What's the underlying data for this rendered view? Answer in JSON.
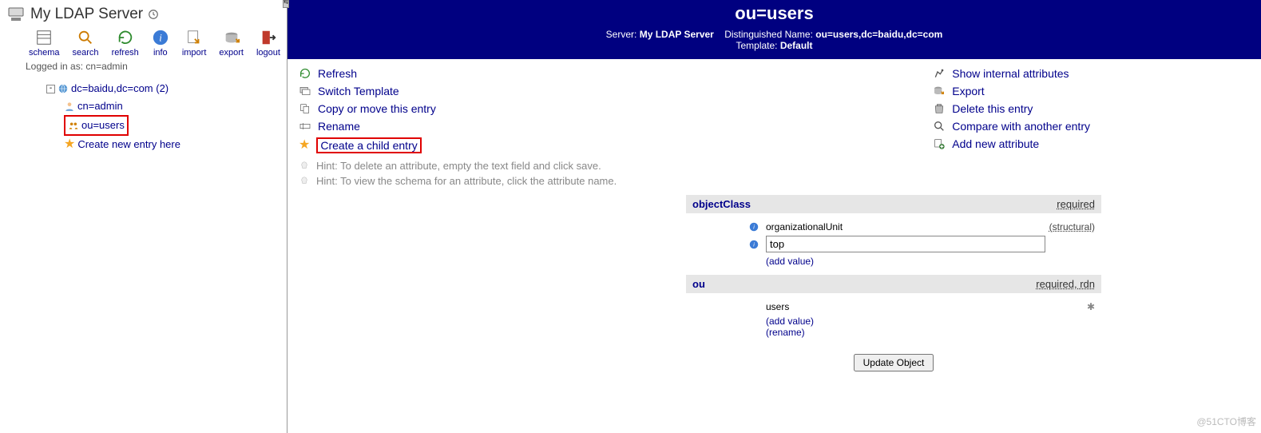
{
  "server": {
    "title": "My LDAP Server",
    "logged_in": "Logged in as: cn=admin"
  },
  "toolbar": [
    {
      "id": "schema",
      "label": "schema"
    },
    {
      "id": "search",
      "label": "search"
    },
    {
      "id": "refresh",
      "label": "refresh"
    },
    {
      "id": "info",
      "label": "info"
    },
    {
      "id": "import",
      "label": "import"
    },
    {
      "id": "export",
      "label": "export"
    },
    {
      "id": "logout",
      "label": "logout"
    }
  ],
  "tree": {
    "root": "dc=baidu,dc=com (2)",
    "children": [
      {
        "label": "cn=admin",
        "icon": "person"
      },
      {
        "label": "ou=users",
        "icon": "ou",
        "highlight": true
      },
      {
        "label": "Create new entry here",
        "icon": "star"
      }
    ]
  },
  "entry": {
    "title": "ou=users",
    "meta": {
      "server_label": "Server:",
      "server_value": "My LDAP Server",
      "dn_label": "Distinguished Name:",
      "dn_value": "ou=users,dc=baidu,dc=com",
      "tmpl_label": "Template:",
      "tmpl_value": "Default"
    }
  },
  "actions_left": [
    {
      "id": "refresh",
      "label": "Refresh"
    },
    {
      "id": "switch-template",
      "label": "Switch Template"
    },
    {
      "id": "copy-move",
      "label": "Copy or move this entry"
    },
    {
      "id": "rename",
      "label": "Rename"
    },
    {
      "id": "create-child",
      "label": "Create a child entry",
      "highlight": true
    }
  ],
  "actions_right": [
    {
      "id": "show-internal",
      "label": "Show internal attributes"
    },
    {
      "id": "export",
      "label": "Export"
    },
    {
      "id": "delete",
      "label": "Delete this entry"
    },
    {
      "id": "compare",
      "label": "Compare with another entry"
    },
    {
      "id": "add-attr",
      "label": "Add new attribute"
    }
  ],
  "hints": [
    "Hint: To delete an attribute, empty the text field and click save.",
    "Hint: To view the schema for an attribute, click the attribute name."
  ],
  "attrs": {
    "objectClass": {
      "name": "objectClass",
      "required": "required",
      "values": [
        {
          "v": "organizationalUnit",
          "note": "(structural)",
          "editable": false
        },
        {
          "v": "top",
          "editable": true
        }
      ],
      "add": "(add value)"
    },
    "ou": {
      "name": "ou",
      "required": "required, rdn",
      "value": "users",
      "add": "(add value)",
      "rename": "(rename)"
    }
  },
  "update_btn": "Update Object",
  "watermark": "@51CTO博客"
}
